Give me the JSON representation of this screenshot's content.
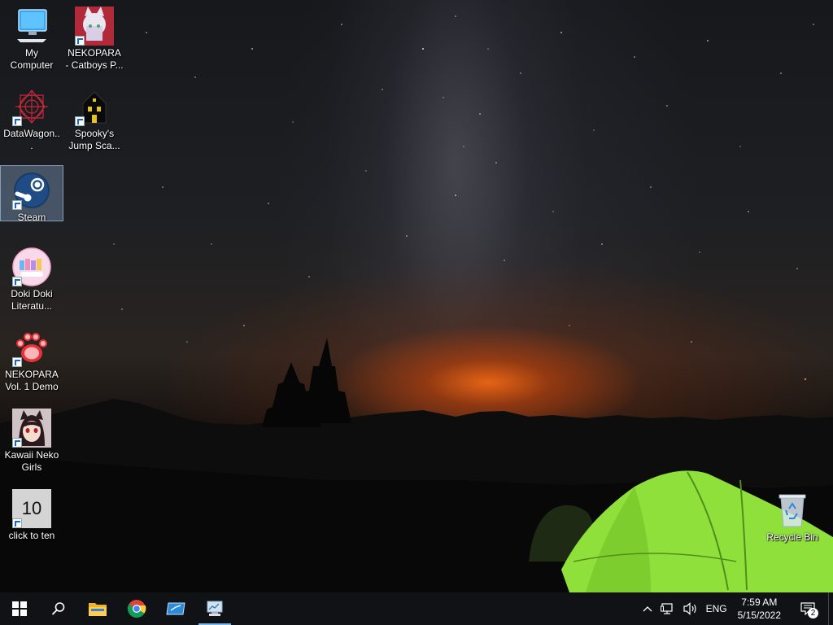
{
  "desktop": {
    "icons": [
      {
        "id": "my-computer",
        "label": "My Computer"
      },
      {
        "id": "nekopara-catboys",
        "label": "NEKOPARA - Catboys P..."
      },
      {
        "id": "datawagon",
        "label": "DataWagon..."
      },
      {
        "id": "spookys",
        "label": "Spooky's Jump Sca..."
      },
      {
        "id": "steam",
        "label": "Steam"
      },
      {
        "id": "doki-doki",
        "label": "Doki Doki Literatu..."
      },
      {
        "id": "nekopara-vol1",
        "label": "NEKOPARA Vol. 1 Demo"
      },
      {
        "id": "kawaii-neko",
        "label": "Kawaii Neko Girls"
      },
      {
        "id": "click-to-ten",
        "label": "click to ten",
        "tile_text": "10"
      },
      {
        "id": "recycle-bin",
        "label": "Recycle Bin"
      }
    ],
    "selected_icon": "steam"
  },
  "taskbar": {
    "pinned": [
      {
        "name": "start",
        "icon": "windows-logo-icon"
      },
      {
        "name": "search",
        "icon": "search-icon"
      },
      {
        "name": "file-explorer",
        "icon": "folder-icon"
      },
      {
        "name": "chrome",
        "icon": "chrome-icon"
      },
      {
        "name": "app-window",
        "icon": "window-app-icon"
      },
      {
        "name": "active-app",
        "icon": "monitor-app-icon",
        "active": true
      }
    ],
    "tray": {
      "language": "ENG",
      "time": "7:59 AM",
      "date": "5/15/2022",
      "notifications_count": "2"
    }
  },
  "colors": {
    "taskbar_bg": "#101215",
    "active_indicator": "#76b9ed",
    "tent_green": "#8fe03a",
    "selection": "#8caad2"
  }
}
